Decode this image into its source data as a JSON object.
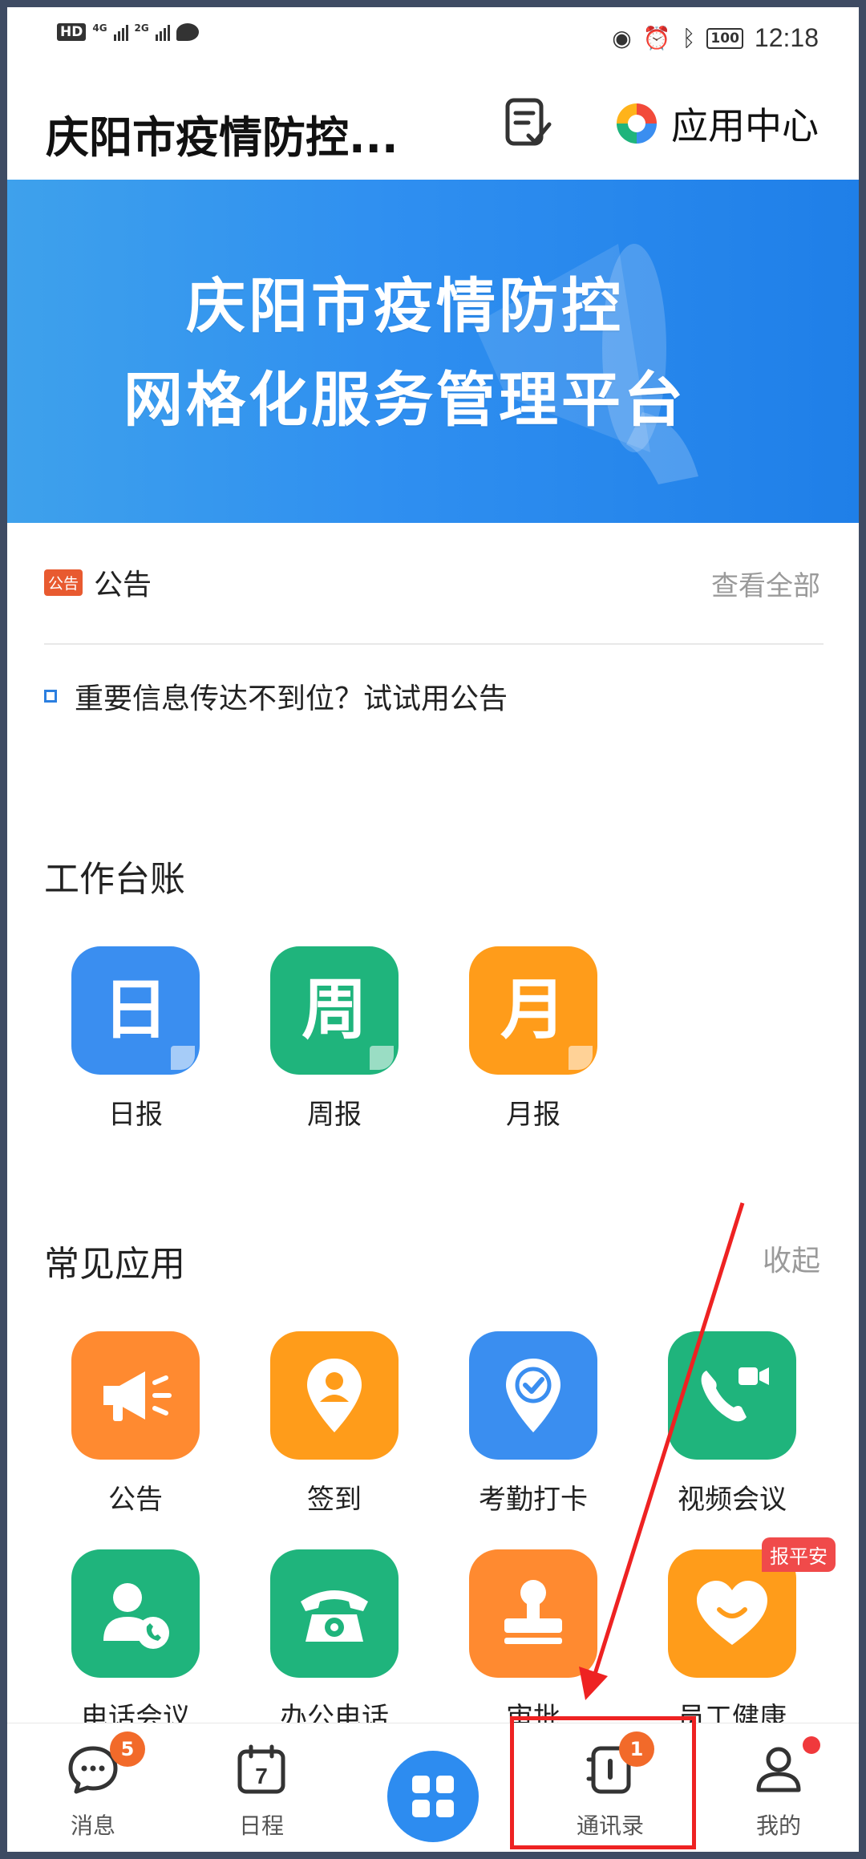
{
  "status_bar": {
    "hd": "HD",
    "net1": "4G",
    "net2": "2G",
    "battery": "100",
    "time": "12:18"
  },
  "header": {
    "title": "庆阳市疫情防控...",
    "app_center_label": "应用中心"
  },
  "banner": {
    "line1": "庆阳市疫情防控",
    "line2": "网格化服务管理平台"
  },
  "notice": {
    "tag": "公告",
    "title": "公告",
    "more": "查看全部",
    "item": "重要信息传达不到位？试试用公告"
  },
  "work_ledger": {
    "title": "工作台账",
    "items": [
      {
        "glyph": "日",
        "label": "日报",
        "color": "#3a8ef0"
      },
      {
        "glyph": "周",
        "label": "周报",
        "color": "#1fb47c"
      },
      {
        "glyph": "月",
        "label": "月报",
        "color": "#ff9c1a"
      }
    ]
  },
  "common_apps": {
    "title": "常见应用",
    "action": "收起",
    "items": [
      {
        "label": "公告",
        "icon": "megaphone-icon",
        "color": "#ff8a30"
      },
      {
        "label": "签到",
        "icon": "location-pin-icon",
        "color": "#ff9c1a"
      },
      {
        "label": "考勤打卡",
        "icon": "check-pin-icon",
        "color": "#3a8ef0"
      },
      {
        "label": "视频会议",
        "icon": "video-call-icon",
        "color": "#1fb47c"
      },
      {
        "label": "电话会议",
        "icon": "person-phone-icon",
        "color": "#1fb47c"
      },
      {
        "label": "办公电话",
        "icon": "telephone-icon",
        "color": "#1fb47c"
      },
      {
        "label": "审批",
        "icon": "stamp-icon",
        "color": "#ff8a30"
      },
      {
        "label": "员工健康",
        "icon": "heart-icon",
        "color": "#ff9c1a"
      }
    ],
    "ribbon": "报平安"
  },
  "bottom_nav": {
    "tabs": [
      {
        "label": "消息",
        "icon": "chat-icon",
        "badge": "5"
      },
      {
        "label": "日程",
        "icon": "calendar-icon",
        "calendar_day": "7"
      },
      {
        "label": "",
        "icon": "grid-icon"
      },
      {
        "label": "通讯录",
        "icon": "contacts-icon",
        "badge": "1"
      },
      {
        "label": "我的",
        "icon": "profile-icon"
      }
    ]
  }
}
